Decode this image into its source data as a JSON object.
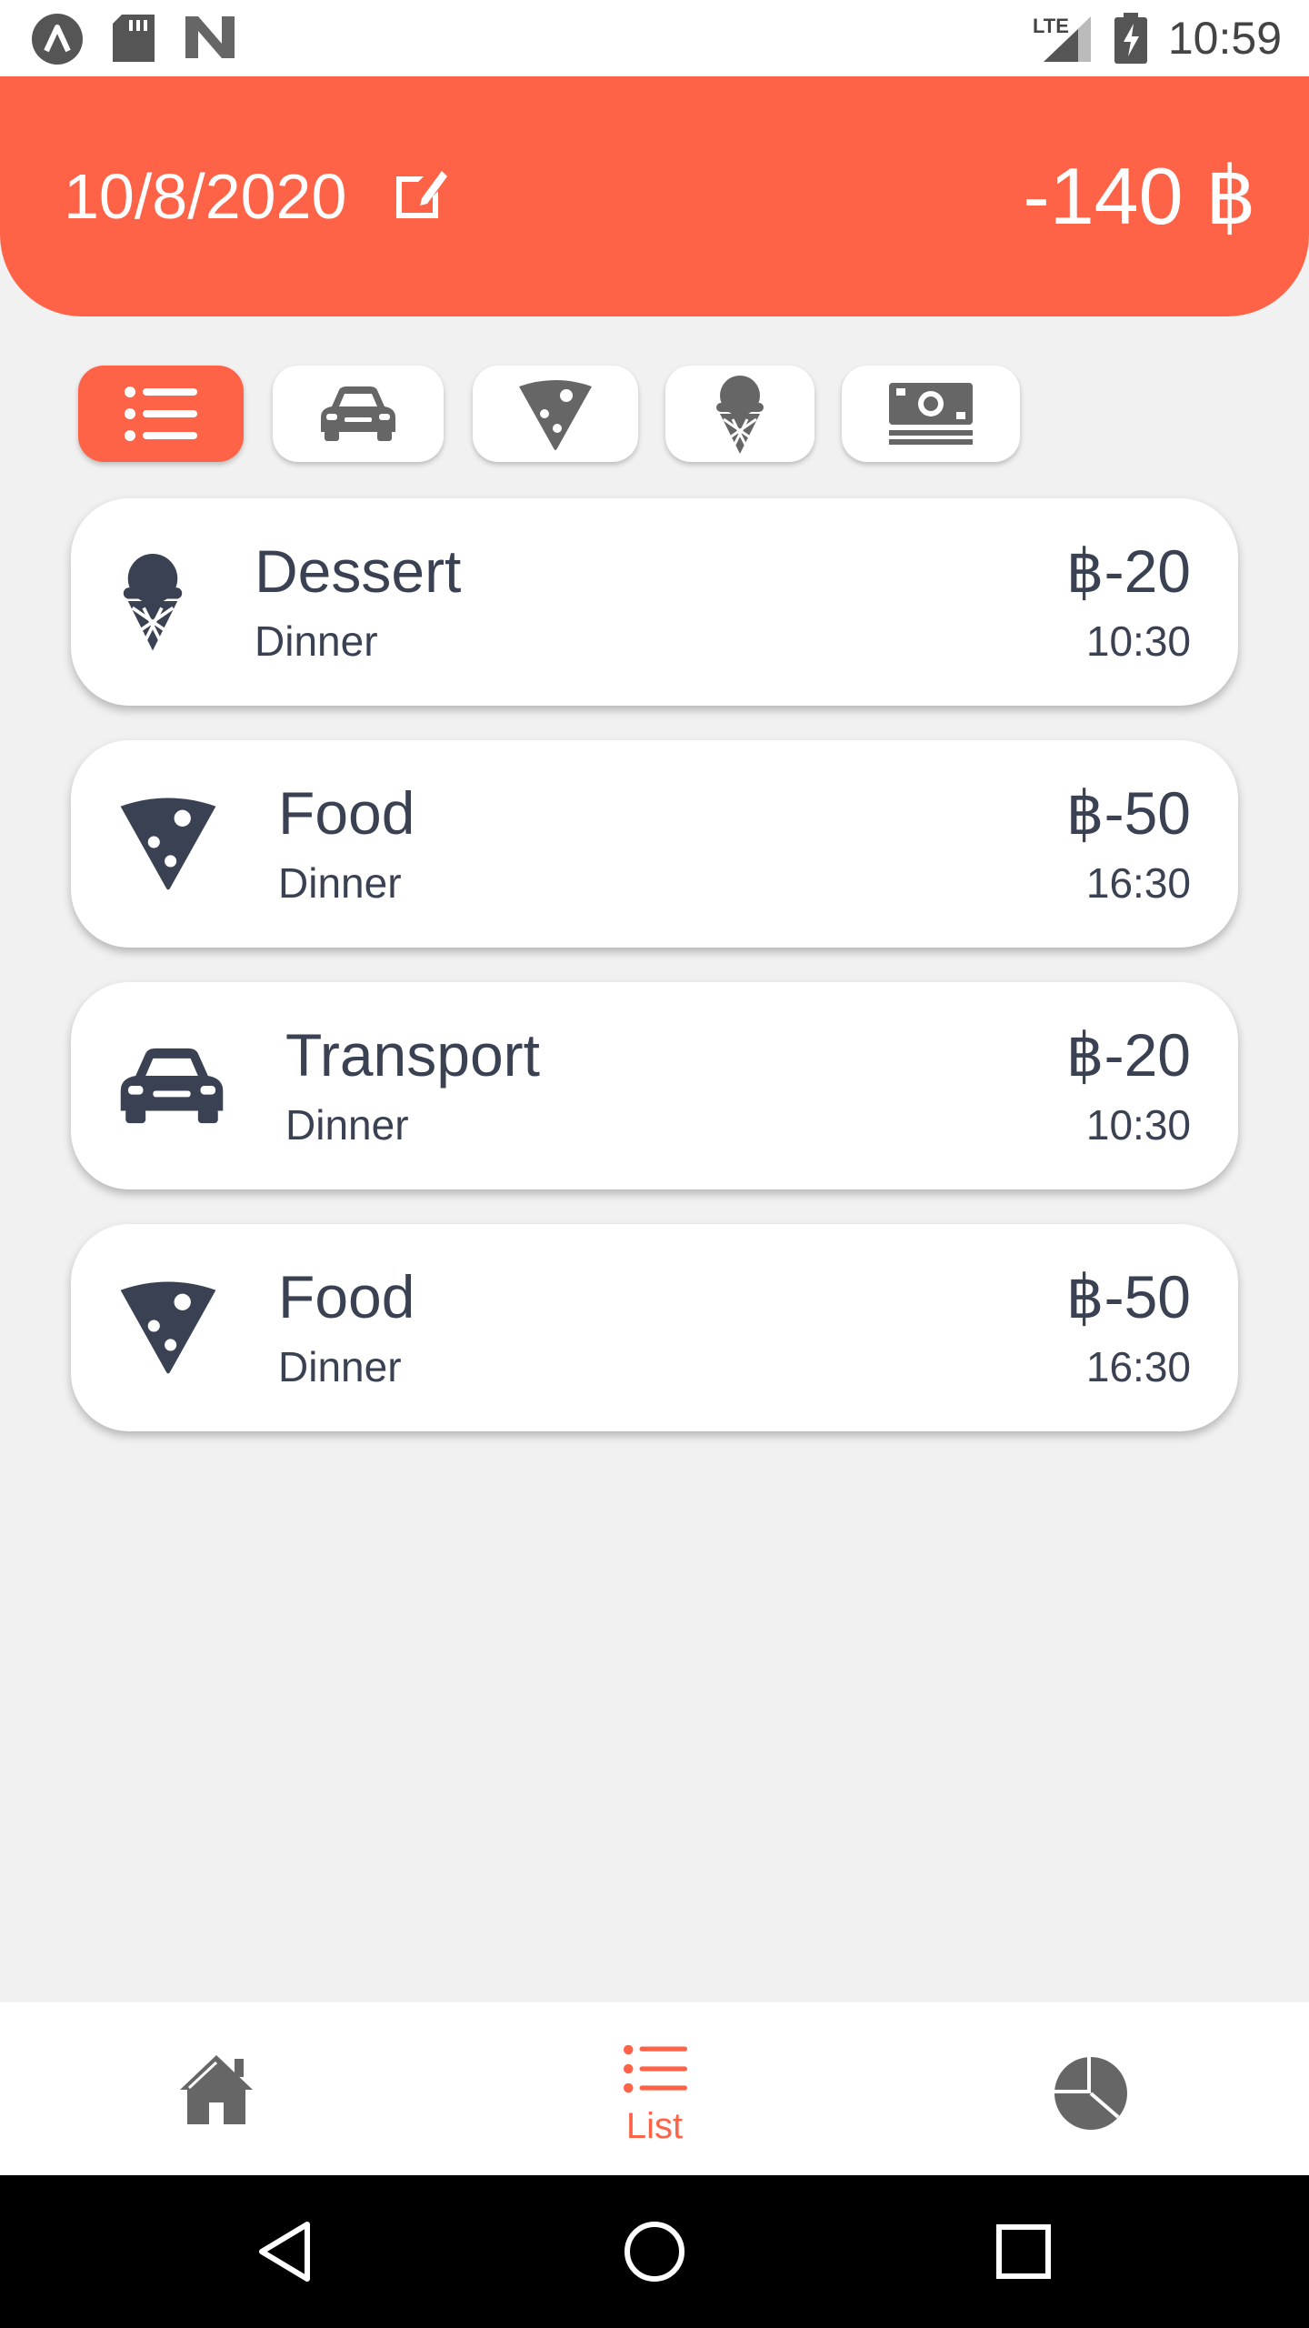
{
  "status_bar": {
    "time": "10:59",
    "network": "LTE",
    "icons": [
      "app-launcher-icon",
      "sd-card-icon",
      "n-logo-icon",
      "signal-icon",
      "battery-charging-icon"
    ]
  },
  "header": {
    "date": "10/8/2020",
    "total": "-140 ฿",
    "edit_icon": "edit-icon",
    "background_color": "#ff6347"
  },
  "filters": [
    {
      "icon": "list-icon",
      "active": true
    },
    {
      "icon": "car-icon",
      "active": false
    },
    {
      "icon": "pizza-icon",
      "active": false
    },
    {
      "icon": "ice-cream-icon",
      "active": false
    },
    {
      "icon": "money-icon",
      "active": false
    }
  ],
  "transactions": [
    {
      "icon": "ice-cream-icon",
      "title": "Dessert",
      "subtitle": "Dinner",
      "amount": "฿-20",
      "time": "10:30"
    },
    {
      "icon": "pizza-icon",
      "title": "Food",
      "subtitle": "Dinner",
      "amount": "฿-50",
      "time": "16:30"
    },
    {
      "icon": "car-icon",
      "title": "Transport",
      "subtitle": "Dinner",
      "amount": "฿-20",
      "time": "10:30"
    },
    {
      "icon": "pizza-icon",
      "title": "Food",
      "subtitle": "Dinner",
      "amount": "฿-50",
      "time": "16:30"
    }
  ],
  "bottom_nav": {
    "items": [
      {
        "icon": "home-icon",
        "label": "",
        "active": false
      },
      {
        "icon": "list-icon",
        "label": "List",
        "active": true
      },
      {
        "icon": "pie-chart-icon",
        "label": "",
        "active": false
      }
    ],
    "active_color": "#ff6347"
  },
  "system_nav": {
    "buttons": [
      "back-icon",
      "home-circle-icon",
      "recents-icon"
    ]
  },
  "colors": {
    "accent": "#ff6347",
    "text_dark": "#3a4152",
    "icon_gray": "#6b6b6b",
    "background": "#f1f1f1"
  }
}
